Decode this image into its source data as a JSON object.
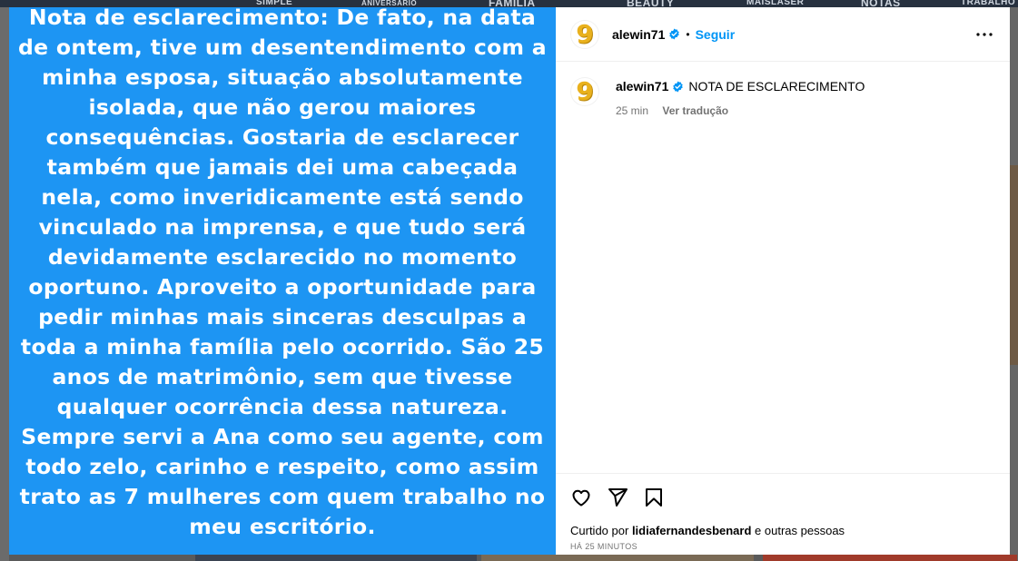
{
  "background": {
    "tiles": [
      "SIMPLE",
      "ANIVERSÁRIO",
      "FAMILIA",
      "BEAUTY",
      "MAISLASER",
      "NOTAS",
      "TRABALHO"
    ]
  },
  "media": {
    "text": "Nota de esclarecimento: De fato, na data de ontem, tive um desentendimento com a minha esposa, situação absolutamente isolada, que não gerou maiores consequências. Gostaria de esclarecer também que jamais dei uma cabeçada nela, como inveridicamente está sendo vinculado na imprensa, e que tudo será devidamente esclarecido no momento oportuno. Aproveito a oportunidade para pedir minhas mais sinceras desculpas a toda a minha família pelo ocorrido. São 25 anos de matrimônio, sem que tivesse qualquer ocorrência dessa natureza. Sempre servi a Ana como seu agente, com todo zelo, carinho e respeito, como assim trato as 7 mulheres com quem trabalho no meu escritório.",
    "background_color": "#1d95f3"
  },
  "header": {
    "username": "alewin71",
    "separator": "•",
    "follow_label": "Seguir",
    "avatar_glyph": "9"
  },
  "caption": {
    "username": "alewin71",
    "text": "NOTA DE ESCLARECIMENTO",
    "time": "25 min",
    "translate_label": "Ver tradução",
    "avatar_glyph": "9"
  },
  "footer": {
    "liked_prefix": "Curtido por",
    "liked_user": "lidiafernandesbenard",
    "liked_suffix": "e outras pessoas",
    "time_ago": "HÁ 25 MINUTOS"
  },
  "colors": {
    "accent": "#0095f6",
    "verified": "#0095f6",
    "muted": "#737373"
  },
  "icons": [
    "verified-badge-icon",
    "more-options-icon",
    "heart-icon",
    "share-icon",
    "bookmark-icon"
  ]
}
